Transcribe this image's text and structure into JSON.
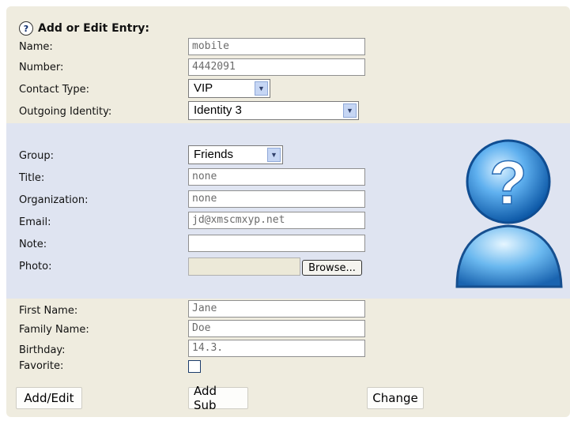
{
  "header": {
    "title": "Add or Edit Entry:",
    "help_icon": "?"
  },
  "fields": {
    "name": {
      "label": "Name:",
      "value": "mobile"
    },
    "number": {
      "label": "Number:",
      "value": "4442091"
    },
    "contact_type": {
      "label": "Contact Type:",
      "value": "VIP"
    },
    "outgoing_identity": {
      "label": "Outgoing Identity:",
      "value": "Identity 3"
    },
    "group": {
      "label": "Group:",
      "value": "Friends"
    },
    "title": {
      "label": "Title:",
      "value": "none"
    },
    "organization": {
      "label": "Organization:",
      "value": "none"
    },
    "email": {
      "label": "Email:",
      "value": "jd@xmscmxyp.net"
    },
    "note": {
      "label": "Note:",
      "value": ""
    },
    "photo": {
      "label": "Photo:",
      "browse_label": "Browse..."
    },
    "first_name": {
      "label": "First Name:",
      "value": "Jane"
    },
    "family_name": {
      "label": "Family Name:",
      "value": "Doe"
    },
    "birthday": {
      "label": "Birthday:",
      "value": "14.3."
    },
    "favorite": {
      "label": "Favorite:",
      "checked": false
    }
  },
  "buttons": {
    "add_edit": "Add/Edit",
    "add_sub": "Add Sub",
    "change": "Change"
  },
  "icons": {
    "avatar": "unknown-contact-avatar-icon",
    "dropdown": "chevron-down-icon"
  },
  "colors": {
    "panel": "#efecdf",
    "band": "#dfe4f1",
    "avatar_blue": "#3b8fd8"
  }
}
